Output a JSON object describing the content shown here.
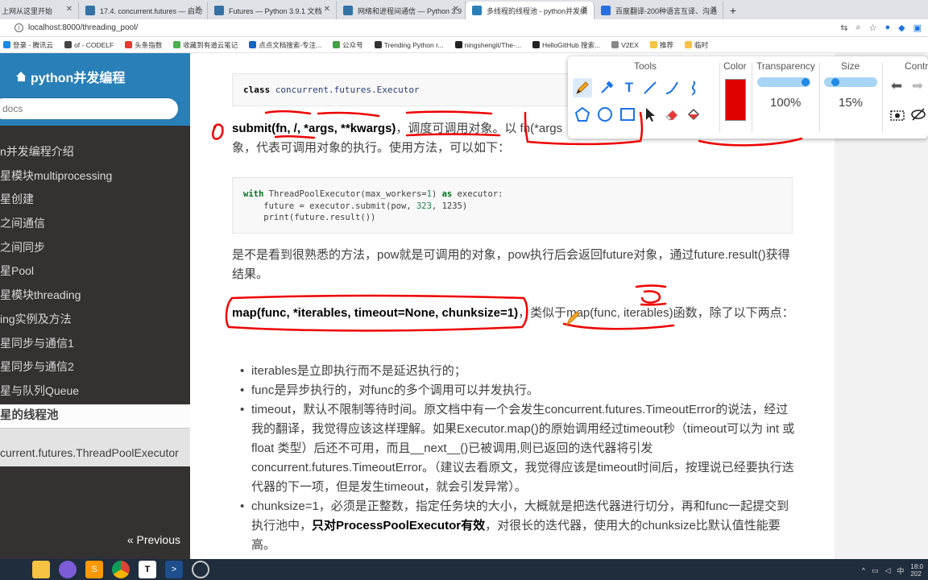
{
  "browser": {
    "tabs": [
      {
        "label": "上网从这里开始",
        "color": "#4caf50"
      },
      {
        "label": "17.4. concurrent.futures — 启动",
        "color": "#3572a5"
      },
      {
        "label": "Futures — Python 3.9.1 文档",
        "color": "#3572a5"
      },
      {
        "label": "网络和进程间通信 — Python 3.9",
        "color": "#3572a5"
      },
      {
        "label": "多线程的线程池 - python并发编",
        "color": "#2980b9"
      },
      {
        "label": "百度翻译-200种语言互译、沟通",
        "color": "#2a6fdb"
      }
    ],
    "new_tab": "+",
    "url": "localhost:8000/threading_pool/",
    "bookmarks": [
      "登录 - 腾讯云",
      "of - CODELF",
      "头条指数",
      "收藏到有道云笔记",
      "点点文档搜索-专注...",
      "公众号",
      "Trending Python r...",
      "ningshengit/The-...",
      "HelloGitHub 搜索...",
      "V2EX",
      "推荐",
      "临时"
    ]
  },
  "sidebar": {
    "title": "python并发编程",
    "search_placeholder": "docs",
    "items": [
      "n并发编程介绍",
      "星模块multiprocessing",
      "星创建",
      "之间通信",
      "之间同步",
      "星Pool",
      "星模块threading",
      "ing实例及方法",
      "星同步与通信1",
      "星同步与通信2",
      "星与队列Queue"
    ],
    "current": "星的线程池",
    "sub": "current.futures.ThreadPoolExecutor",
    "previous": "« Previous"
  },
  "content": {
    "code1": {
      "kw": "class",
      "name": "concurrent.futures.Executor"
    },
    "submit_sig": "submit(fn, /, *args, **kwargs)",
    "submit_desc_a": "，调度可调用对象。以 fn(*args",
    "submit_desc_b": "象，代表可调用对象的执行。使用方法，可以如下：",
    "code2_lines": [
      [
        "with",
        " ThreadPoolExecutor(max_workers=",
        "1",
        ") ",
        "as",
        " executor:"
      ],
      [
        "",
        "    future = executor.submit(pow, ",
        "323",
        ", ",
        "",
        "1235)"
      ],
      [
        "",
        "    print(future.result())",
        "",
        "",
        "",
        ""
      ]
    ],
    "para1": "是不是看到很熟悉的方法，pow就是可调用的对象，pow执行后会返回future对象，通过future.result()获得结果。",
    "map_sig": "map(func, *iterables, timeout=None, chunksize=1)",
    "map_desc": "，类似于map(func, iterables)函数，除了以下两点：",
    "bullets": [
      "iterables是立即执行而不是延迟执行的；",
      "func是异步执行的，对func的多个调用可以并发执行。",
      "timeout，默认不限制等待时间。原文档中有一个会发生concurrent.futures.TimeoutError的说法，经过我的翻译，我觉得应该这样理解。如果Executor.map()的原始调用经过timeout秒（timeout可以为 int 或 float 类型）后还不可用，而且__next__()已被调用,则已返回的迭代器将引发concurrent.futures.TimeoutError。（建议去看原文，我觉得应该是timeout时间后，按理说已经要执行迭代器的下一项，但是发生timeout，就会引发异常）。"
    ],
    "bullet4_a": "chunksize=1，必须是正整数，指定任务块的大小，大概就是把迭代器进行切分，再和func一起提交到执行池中，",
    "bullet4_bold": "只对ProcessPoolExecutor有效",
    "bullet4_b": "，对很长的迭代器，使用大的chunksize比默认值性能要高。"
  },
  "drawbar": {
    "tools_label": "Tools",
    "color_label": "Color",
    "transparency_label": "Transparency",
    "size_label": "Size",
    "control_label": "Contr",
    "transparency_value": "100%",
    "size_value": "15%",
    "color": "#e00000",
    "transparency_level": 1.0,
    "size_level": 0.15
  },
  "taskbar": {
    "ime": "中",
    "time": "18:0",
    "date": "202"
  }
}
